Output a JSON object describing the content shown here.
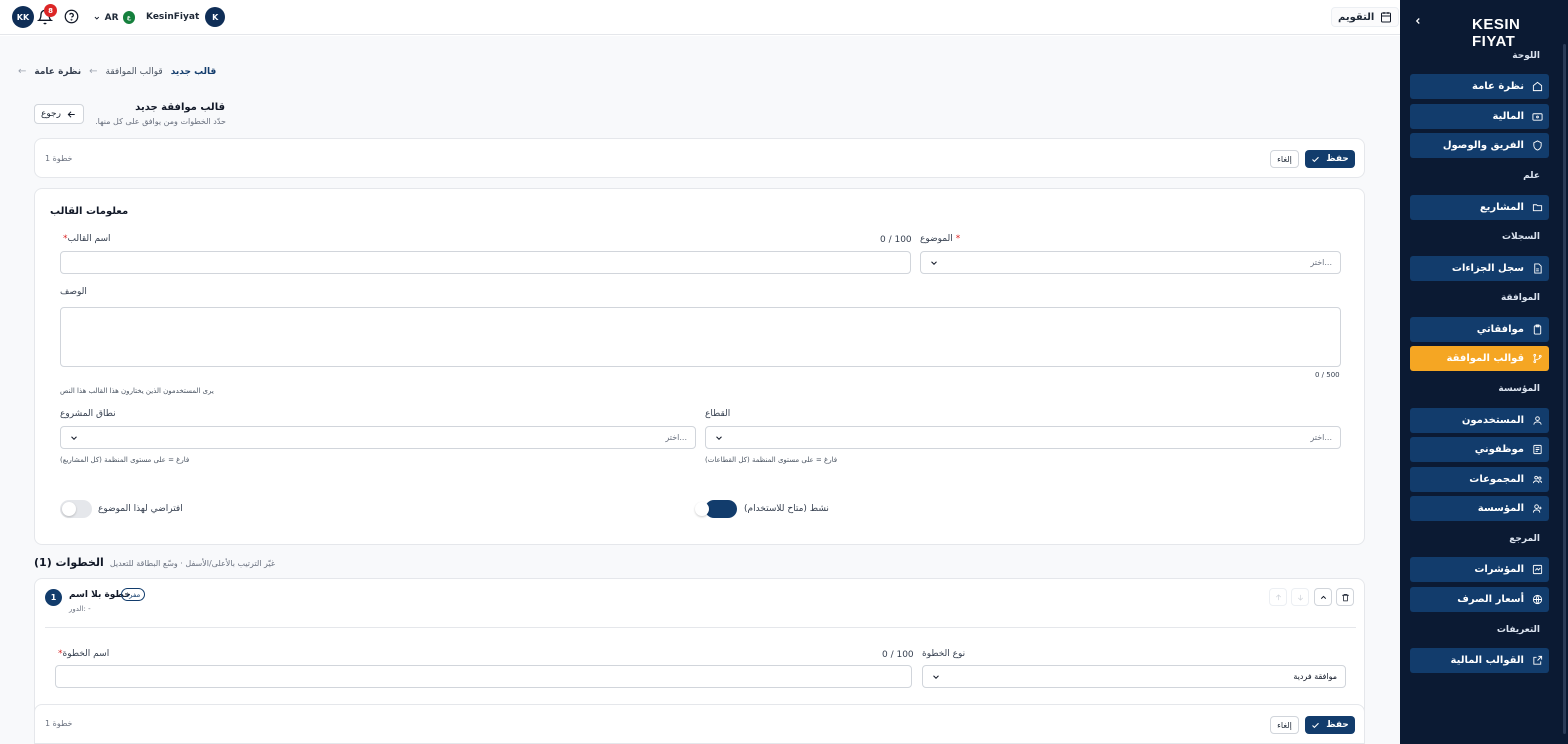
{
  "topbar": {
    "user_initials": "KK",
    "notification_count": "8",
    "language": "AR",
    "flag_text": "ع",
    "org_name": "KesinFiyat",
    "org_initial": "K",
    "calendar_label": "التقويم"
  },
  "sidebar": {
    "logo": "KESIN FIYAT",
    "sections": {
      "dashboard": "اللوحة",
      "general": "علم",
      "records": "السجلات",
      "approval": "الموافقة",
      "institution": "المؤسسة",
      "reference": "المرجع",
      "definitions": "التعريفات"
    },
    "items": [
      {
        "label": "نظرة عامة",
        "icon": "home-icon"
      },
      {
        "label": "المالية",
        "icon": "wallet-icon"
      },
      {
        "label": "الفريق والوصول",
        "icon": "shield-icon"
      },
      {
        "label": "المشاريع",
        "icon": "folder-icon"
      },
      {
        "label": "سجل الجزاءات",
        "icon": "document-icon"
      },
      {
        "label": "موافقاتي",
        "icon": "clipboard-icon"
      },
      {
        "label": "قوالب الموافقة",
        "icon": "branch-icon"
      },
      {
        "label": "المستخدمون",
        "icon": "user-icon"
      },
      {
        "label": "موظفوني",
        "icon": "id-card-icon"
      },
      {
        "label": "المجموعات",
        "icon": "users-icon"
      },
      {
        "label": "المؤسسة",
        "icon": "building-user-icon"
      },
      {
        "label": "المؤشرات",
        "icon": "chart-icon"
      },
      {
        "label": "أسعار الصرف",
        "icon": "globe-icon"
      },
      {
        "label": "القوالب المالية",
        "icon": "external-icon"
      }
    ],
    "active_item": "قوالب الموافقة",
    "accent_color": "#f5a623",
    "item_color": "#123c6c",
    "background_color": "#0b1a33"
  },
  "breadcrumb": {
    "items": [
      "نظرة عامة",
      "قوالب الموافقة",
      "قالب جديد"
    ]
  },
  "page_header": {
    "title": "قالب موافقة جديد",
    "subtitle": "حدّد الخطوات ومن يوافق على كل منها.",
    "back_label": "رجوع"
  },
  "action_bar": {
    "save_label": "حفظ",
    "cancel_label": "إلغاء",
    "step_count": "خطوة 1"
  },
  "template_info": {
    "heading": "معلومات القالب",
    "topic_label": "الموضوع",
    "topic_placeholder": "اختر...",
    "name_label": "اسم القالب",
    "name_counter": "0 / 100",
    "name_value": "",
    "description_label": "الوصف",
    "description_value": "",
    "description_counter": "0 / 500",
    "description_hint": "يرى المستخدمون الذين يختارون هذا القالب هذا النص",
    "sector_label": "القطاع",
    "sector_placeholder": "اختر...",
    "sector_hint": "فارغ = على مستوى المنظمة (كل القطاعات)",
    "project_scope_label": "نطاق المشروع",
    "project_scope_placeholder": "اختر...",
    "project_scope_hint": "فارغ = على مستوى المنظمة (كل المشاريع)",
    "active_label": "نشط (متاح للاستخدام)",
    "active_on": true,
    "default_label": "افتراضي لهذا الموضوع",
    "default_on": false
  },
  "steps": {
    "heading": "الخطوات (1)",
    "hint": "غيّر الترتيب بالأعلى/الأسفل · وسّع البطاقة للتعديل",
    "items": [
      {
        "number": "1",
        "name": "خطوة بلا اسم",
        "badge": "مفرد",
        "role_line": "الدور: -",
        "type_label": "نوع الخطوة",
        "type_value": "موافقة فردية",
        "name_label": "اسم الخطوة",
        "name_counter": "0 / 100",
        "name_value": ""
      }
    ]
  }
}
